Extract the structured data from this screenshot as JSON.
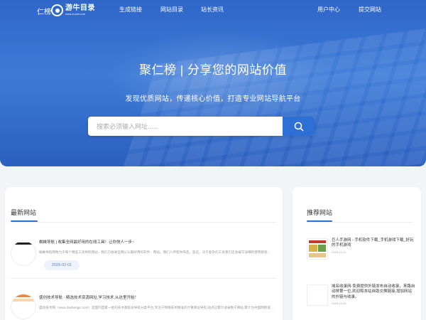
{
  "nav": {
    "brand_text": "仁榜",
    "logo_name": "游牛目录",
    "logo_url": "www.zuniw.com",
    "links": [
      "生成链接",
      "网站目录",
      "站长资讯"
    ],
    "right_links": [
      "用户中心",
      "提交网站"
    ]
  },
  "hero": {
    "title": "聚仁榜 | 分享您的网站价值",
    "subtitle": "发现优质网站，传递核心价值，打造专业网站导航平台"
  },
  "search": {
    "placeholder": "搜索必须输入网址......",
    "button_icon": "search-icon"
  },
  "latest": {
    "title": "最新网站",
    "items": [
      {
        "title": "蜘蛛导航 | 收集全网最好用的在线工具！让你快人一步~",
        "desc": "蜘蛛导航网致力于每个精品工具导航网站，我们只收录全网公认最好用的软件、网站。我们人所帮你筛选、鉴证，对于复杂的工具我们还会编写详细的使用教程...",
        "date": "2026-02-01"
      },
      {
        "title": "盛创技术导航 - 精选技术资源网址,学习技术,从这里开始！",
        "desc": "盛创技术网（www.dashengic.com）是国内首家一批的技术教程总导航分类平台,专注于网络技术精准的计算网址导航,站点已累计收录数千网站,累计为中国网民提...",
        "date": ""
      }
    ]
  },
  "recommended": {
    "title": "推荐网站",
    "items": [
      {
        "title": "巨人手游网 - 手机软件下载_手机游戏下载_好玩的手机游戏",
        "date": "2025-12-24"
      },
      {
        "title": "域名收录网-免费提供外链发布自动收录，来路自动排第一位,欢迎和本站自助交换链接,增加网站的外链与收录。",
        "date": "2025-12-29"
      }
    ]
  },
  "colors": {
    "accent": "#2e6fd6",
    "hero_top": "#2f66c8",
    "date_chip_bg": "#eef3fb"
  }
}
